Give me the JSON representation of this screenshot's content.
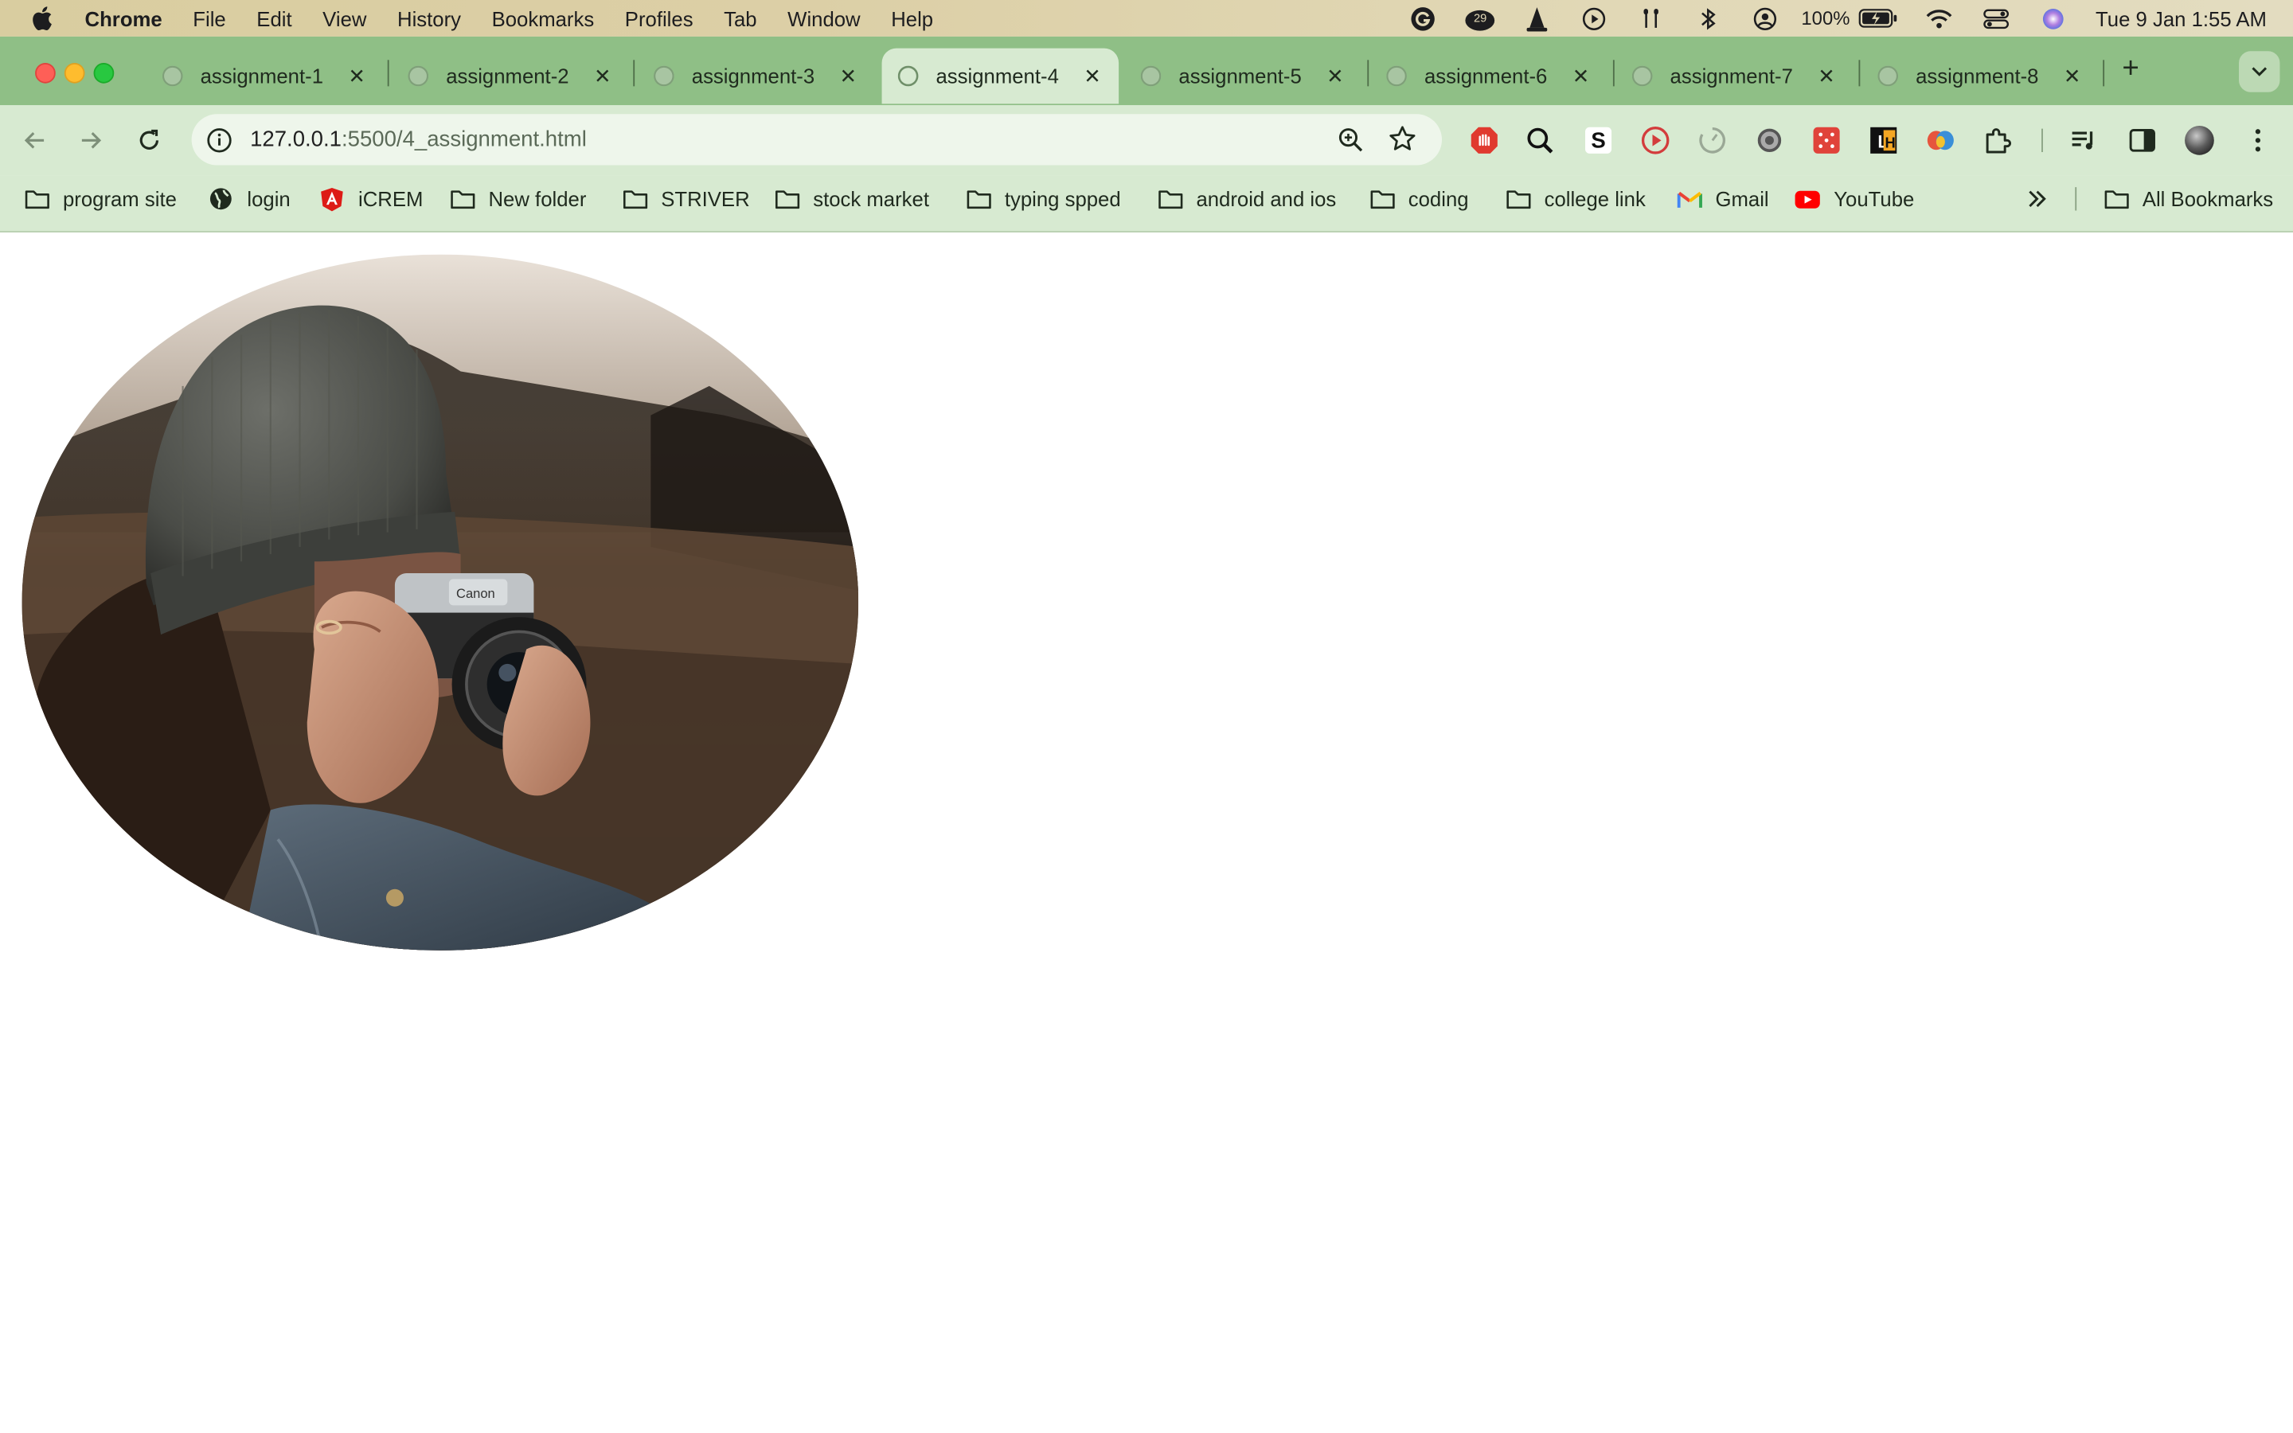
{
  "menubar": {
    "app_name": "Chrome",
    "menus": [
      "File",
      "Edit",
      "View",
      "History",
      "Bookmarks",
      "Profiles",
      "Tab",
      "Window",
      "Help"
    ],
    "notification_badge": "29",
    "battery_percent": "100%",
    "clock": "Tue 9 Jan  1:55 AM"
  },
  "tabs": [
    {
      "label": "assignment-1"
    },
    {
      "label": "assignment-2"
    },
    {
      "label": "assignment-3"
    },
    {
      "label": "assignment-4",
      "active": true
    },
    {
      "label": "assignment-5"
    },
    {
      "label": "assignment-6"
    },
    {
      "label": "assignment-7"
    },
    {
      "label": "assignment-8"
    }
  ],
  "omnibox": {
    "host": "127.0.0.1",
    "path": ":5500/4_assignment.html"
  },
  "bookmarks": {
    "items": [
      {
        "label": "program site",
        "icon": "folder-icon"
      },
      {
        "label": "login",
        "icon": "globe-icon"
      },
      {
        "label": "iCREM",
        "icon": "angular-icon"
      },
      {
        "label": "New folder",
        "icon": "folder-icon"
      },
      {
        "label": "STRIVER",
        "icon": "folder-icon"
      },
      {
        "label": "stock market",
        "icon": "folder-icon"
      },
      {
        "label": "typing spped",
        "icon": "folder-icon"
      },
      {
        "label": "android and ios",
        "icon": "folder-icon"
      },
      {
        "label": "coding",
        "icon": "folder-icon"
      },
      {
        "label": "college link",
        "icon": "folder-icon"
      },
      {
        "label": "Gmail",
        "icon": "gmail-icon"
      },
      {
        "label": "YouTube",
        "icon": "youtube-icon"
      }
    ],
    "all_bookmarks": "All Bookmarks"
  },
  "colors": {
    "tabstrip": "#8fbf86",
    "toolbar": "#d7ead1",
    "active_tab": "#d7ead1"
  }
}
